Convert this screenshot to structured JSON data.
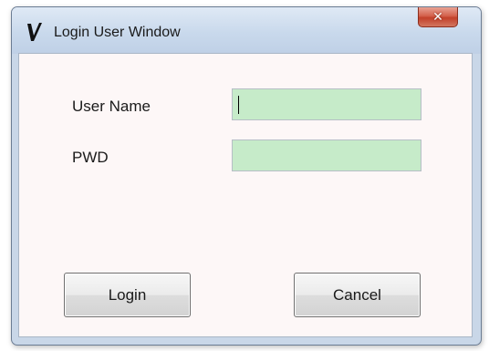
{
  "window": {
    "title": "Login User Window",
    "icon": "v-logo-icon",
    "close_glyph": "✕",
    "close_icon": "close-icon"
  },
  "form": {
    "username_label": "User Name",
    "username_value": "",
    "pwd_label": "PWD",
    "pwd_value": ""
  },
  "buttons": {
    "login_label": "Login",
    "cancel_label": "Cancel"
  },
  "colors": {
    "input_background": "#c6ebc9",
    "client_background": "#fdf7f7",
    "close_button": "#c2402a"
  }
}
